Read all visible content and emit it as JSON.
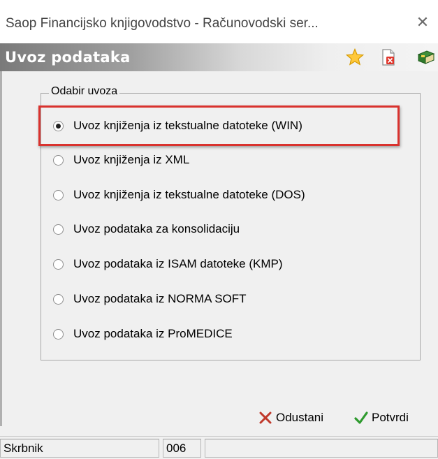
{
  "window": {
    "title": "Saop Financijsko knjigovodstvo - Računovodski ser...",
    "close_icon": "close-icon"
  },
  "header": {
    "title": "Uvoz podataka",
    "icons": [
      "star-icon",
      "document-delete-icon",
      "book-icon"
    ]
  },
  "group": {
    "label": "Odabir uvoza",
    "options": [
      {
        "label": "Uvoz knjiženja iz tekstualne datoteke (WIN)",
        "selected": true
      },
      {
        "label": "Uvoz knjiženja iz XML",
        "selected": false
      },
      {
        "label": "Uvoz knjiženja iz tekstualne datoteke (DOS)",
        "selected": false
      },
      {
        "label": "Uvoz podataka za konsolidaciju",
        "selected": false
      },
      {
        "label": "Uvoz podataka iz ISAM datoteke (KMP)",
        "selected": false
      },
      {
        "label": "Uvoz podataka iz NORMA SOFT",
        "selected": false
      },
      {
        "label": "Uvoz podataka iz ProMEDICE",
        "selected": false
      }
    ]
  },
  "buttons": {
    "cancel_label": "Odustani",
    "confirm_label": "Potvrdi"
  },
  "status": {
    "user": "Skrbnik",
    "code": "006",
    "extra": ""
  },
  "colors": {
    "highlight": "#d9322e",
    "header_dark": "#7a7a7a",
    "cancel_icon": "#c0392b",
    "confirm_icon": "#2e9a2e"
  }
}
